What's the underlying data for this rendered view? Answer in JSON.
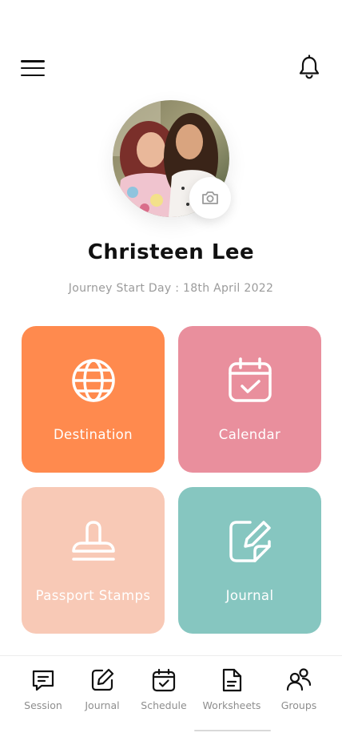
{
  "header": {
    "menu_icon": "hamburger-menu-icon",
    "notification_icon": "bell-icon"
  },
  "profile": {
    "name": "Christeen Lee",
    "journey_text": "Journey Start Day : 18th April 2022",
    "camera_icon": "camera-icon"
  },
  "tiles": [
    {
      "label": "Destination",
      "icon": "globe-icon",
      "color": "#ff8a4e"
    },
    {
      "label": "Calendar",
      "icon": "calendar-check-icon",
      "color": "#e98f9d"
    },
    {
      "label": "Passport Stamps",
      "icon": "stamp-icon",
      "color": "#f8c9b6"
    },
    {
      "label": "Journal",
      "icon": "edit-note-icon",
      "color": "#86c6c0"
    }
  ],
  "bottom_nav": [
    {
      "label": "Session",
      "icon": "chat-icon"
    },
    {
      "label": "Journal",
      "icon": "edit-icon"
    },
    {
      "label": "Schedule",
      "icon": "calendar-check-icon"
    },
    {
      "label": "Worksheets",
      "icon": "document-icon"
    },
    {
      "label": "Groups",
      "icon": "group-icon"
    }
  ]
}
